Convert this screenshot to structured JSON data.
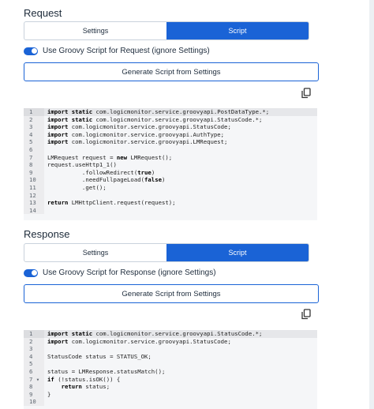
{
  "request": {
    "title": "Request",
    "tabs": [
      {
        "label": "Settings",
        "active": false
      },
      {
        "label": "Script",
        "active": true
      }
    ],
    "toggle_label": "Use Groovy Script for Request (ignore Settings)",
    "toggle_on": true,
    "generate_label": "Generate Script from Settings",
    "code": [
      {
        "n": "1",
        "t": [
          {
            "k": 1,
            "s": "import"
          },
          {
            "k": 1,
            "s": " static"
          },
          {
            "k": 0,
            "s": " com.logicmonitor.service.groovyapi.PostDataType.*;"
          }
        ]
      },
      {
        "n": "2",
        "t": [
          {
            "k": 1,
            "s": "import"
          },
          {
            "k": 1,
            "s": " static"
          },
          {
            "k": 0,
            "s": " com.logicmonitor.service.groovyapi.StatusCode.*;"
          }
        ]
      },
      {
        "n": "3",
        "t": [
          {
            "k": 1,
            "s": "import"
          },
          {
            "k": 0,
            "s": " com.logicmonitor.service.groovyapi.StatusCode;"
          }
        ]
      },
      {
        "n": "4",
        "t": [
          {
            "k": 1,
            "s": "import"
          },
          {
            "k": 0,
            "s": " com.logicmonitor.service.groovyapi.AuthType;"
          }
        ]
      },
      {
        "n": "5",
        "t": [
          {
            "k": 1,
            "s": "import"
          },
          {
            "k": 0,
            "s": " com.logicmonitor.service.groovyapi.LMRequest;"
          }
        ]
      },
      {
        "n": "6",
        "t": []
      },
      {
        "n": "7",
        "t": [
          {
            "k": 0,
            "s": "LMRequest request = "
          },
          {
            "k": 1,
            "s": "new"
          },
          {
            "k": 0,
            "s": " LMRequest();"
          }
        ]
      },
      {
        "n": "8",
        "t": [
          {
            "k": 0,
            "s": "request.useHttp1_1()"
          }
        ]
      },
      {
        "n": "9",
        "t": [
          {
            "k": 0,
            "s": "          .followRedirect("
          },
          {
            "k": 1,
            "s": "true"
          },
          {
            "k": 0,
            "s": ")"
          }
        ]
      },
      {
        "n": "10",
        "t": [
          {
            "k": 0,
            "s": "          .needFullpageLoad("
          },
          {
            "k": 1,
            "s": "false"
          },
          {
            "k": 0,
            "s": ")"
          }
        ]
      },
      {
        "n": "11",
        "t": [
          {
            "k": 0,
            "s": "          .get();"
          }
        ]
      },
      {
        "n": "12",
        "t": []
      },
      {
        "n": "13",
        "t": [
          {
            "k": 1,
            "s": "return"
          },
          {
            "k": 0,
            "s": " LMHttpClient.request(request);"
          }
        ]
      },
      {
        "n": "14",
        "t": []
      }
    ]
  },
  "response": {
    "title": "Response",
    "tabs": [
      {
        "label": "Settings",
        "active": false
      },
      {
        "label": "Script",
        "active": true
      }
    ],
    "toggle_label": "Use Groovy Script for Response (ignore Settings)",
    "toggle_on": true,
    "generate_label": "Generate Script from Settings",
    "code": [
      {
        "n": "1",
        "t": [
          {
            "k": 1,
            "s": "import"
          },
          {
            "k": 1,
            "s": " static"
          },
          {
            "k": 0,
            "s": " com.logicmonitor.service.groovyapi.StatusCode.*;"
          }
        ]
      },
      {
        "n": "2",
        "t": [
          {
            "k": 1,
            "s": "import"
          },
          {
            "k": 0,
            "s": " com.logicmonitor.service.groovyapi.StatusCode;"
          }
        ]
      },
      {
        "n": "3",
        "t": []
      },
      {
        "n": "4",
        "t": [
          {
            "k": 0,
            "s": "StatusCode status = STATUS_OK;"
          }
        ]
      },
      {
        "n": "5",
        "t": []
      },
      {
        "n": "6",
        "t": [
          {
            "k": 0,
            "s": "status = LMResponse.statusMatch();"
          }
        ]
      },
      {
        "n": "7 ▾",
        "t": [
          {
            "k": 1,
            "s": "if"
          },
          {
            "k": 0,
            "s": " (!status.isOK()) {"
          }
        ]
      },
      {
        "n": "8",
        "t": [
          {
            "k": 0,
            "s": "    "
          },
          {
            "k": 1,
            "s": "return"
          },
          {
            "k": 0,
            "s": " status;"
          }
        ]
      },
      {
        "n": "9",
        "t": [
          {
            "k": 0,
            "s": "}"
          }
        ]
      },
      {
        "n": "10",
        "t": []
      }
    ]
  },
  "icons": {
    "copy": "copy-icon"
  },
  "colors": {
    "accent": "#1a63d6",
    "code_bg": "#f5f6f8"
  }
}
